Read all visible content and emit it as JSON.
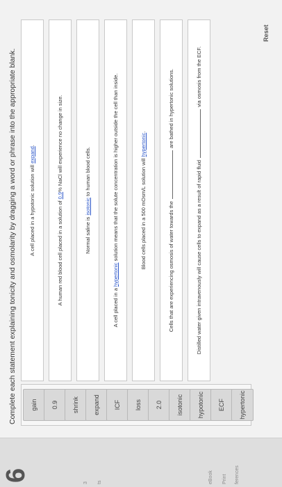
{
  "question_number": "6",
  "instructions": "Complete each statement explaining tonicity and osmolarity by dragging a word or phrase into the appropriate blank.",
  "side_nav": [
    "3",
    "ts",
    "eBook",
    "Print",
    "ferences"
  ],
  "word_bank": [
    "gain",
    "0.9",
    "shrink",
    "expand",
    "ICF",
    "loss",
    "2.0",
    "isotonic",
    "hypotonic",
    "ECF",
    "hypertonic"
  ],
  "statements": [
    {
      "pre": "A cell placed in a hypotonic solution will ",
      "word": "expand",
      "post": "."
    },
    {
      "pre": "A human red blood cell placed in a solution of ",
      "word": "0.9",
      "post": "% NaCl will experience no change in size."
    },
    {
      "pre": "Normal saline is ",
      "word": "isotonic",
      "post": " to human blood cells."
    },
    {
      "pre": "A cell placed in a ",
      "word": "hypertonic",
      "post": " solution means that the solute concentration is higher outside the cell than inside."
    },
    {
      "pre": "Blood cells placed in a 500 mOsm/L solution will ",
      "word": "hypertonic",
      "post": "."
    },
    {
      "pre": "Cells that are experiencing osmosis of water towards the",
      "word": "",
      "post": "are bathed in hypertonic solutions."
    },
    {
      "pre": "Distilled water given intravenously will cause cells to expand as a result of rapid fluid",
      "word": "",
      "post": "via osmosis from the ECF."
    }
  ],
  "reset_label": "Reset"
}
